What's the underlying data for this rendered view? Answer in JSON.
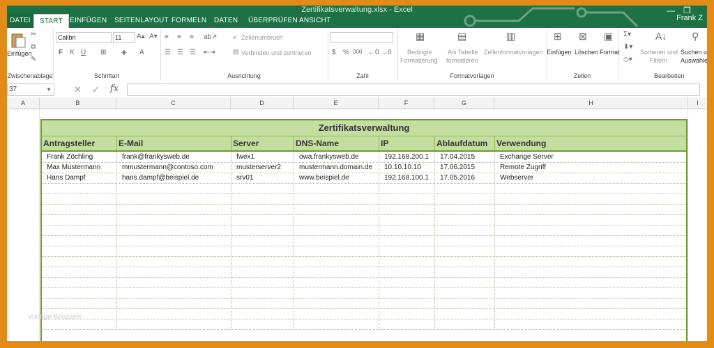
{
  "window": {
    "title": "Zertifikatsverwaltung.xlsx - Excel",
    "user": "Frank Z",
    "minimize": "—",
    "restore": "❐"
  },
  "tabs": [
    "DATEI",
    "START",
    "EINFÜGEN",
    "SEITENLAYOUT",
    "FORMELN",
    "DATEN",
    "ÜBERPRÜFEN",
    "ANSICHT"
  ],
  "ribbon": {
    "clipboard": {
      "paste": "Einfügen",
      "label": "Zwischenablage"
    },
    "font": {
      "name": "Calibri",
      "size": "11",
      "bold": "F",
      "italic": "K",
      "underline": "U",
      "label": "Schriftart"
    },
    "alignment": {
      "wrap": "Zeilenumbruch",
      "merge": "Verbinden und zentrieren",
      "label": "Ausrichtung"
    },
    "number": {
      "currency": "$",
      "percent": "%",
      "thousands": "000",
      "label": "Zahl"
    },
    "styles": {
      "conditional_1": "Bedingte",
      "conditional_2": "Formatierung",
      "table_1": "Als Tabelle",
      "table_2": "formatieren",
      "cell_styles": "Zellenformatvorlagen",
      "label": "Formatvorlagen"
    },
    "cells": {
      "insert": "Einfügen",
      "delete": "Löschen",
      "format": "Format",
      "label": "Zellen"
    },
    "editing": {
      "sort_1": "Sortieren und",
      "sort_2": "Filtern",
      "find_1": "Suchen und",
      "find_2": "Auswählen",
      "label": "Bearbeiten"
    }
  },
  "formula_bar": {
    "name_box": "37",
    "cancel": "✕",
    "enter": "✓",
    "fx": "fx",
    "value": ""
  },
  "columns": [
    "A",
    "B",
    "C",
    "D",
    "E",
    "F",
    "G",
    "H",
    "I"
  ],
  "sheet": {
    "title": "Zertifikatsverwaltung",
    "headers": [
      "Antragsteller",
      "E-Mail",
      "Server",
      "DNS-Name",
      "IP",
      "Ablaufdatum",
      "Verwendung"
    ],
    "rows": [
      [
        "Frank Zöchling",
        "frank@frankysweb.de",
        "fwex1",
        "owa.frankysweb.de",
        "192.168.200.1",
        "17.04.2015",
        "Exchange Server"
      ],
      [
        "Max Mustermann",
        "mmustermann@contoso.com",
        "musterserver2",
        "mustermann.domain.de",
        "10.10.10.10",
        "17.06.2015",
        "Remote Zugriff"
      ],
      [
        "Hans Dampf",
        "hans.dampf@beispiel.de",
        "srv01",
        "www.beispiel.de",
        "192.168.100.1",
        "17.05.2016",
        "Webserver"
      ]
    ],
    "empty_rows": 14
  },
  "watermark": "Vorlage Beispiele"
}
